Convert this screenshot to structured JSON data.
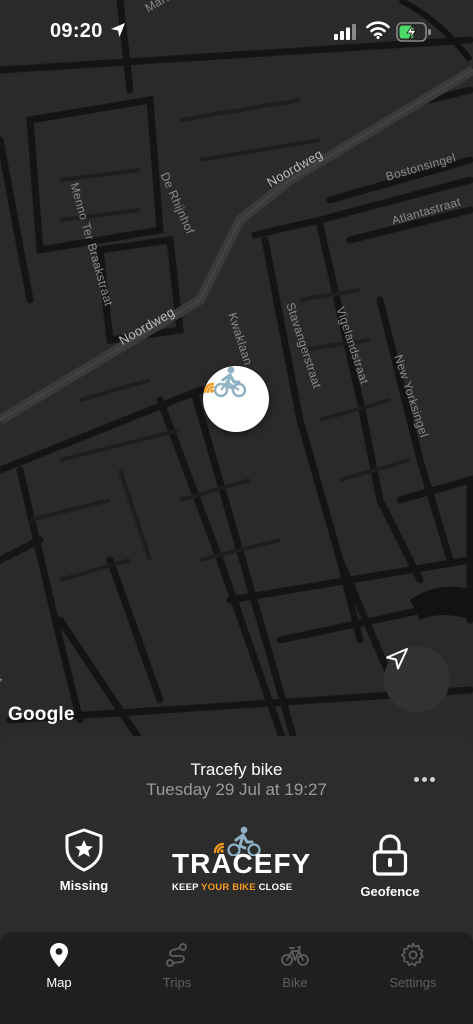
{
  "status_bar": {
    "time": "09:20",
    "location_icon": "location-arrow-icon",
    "signal_icon": "cellular-signal-icon",
    "wifi_icon": "wifi-icon",
    "battery_icon": "battery-charging-icon"
  },
  "map": {
    "attribution": "Google",
    "streets": {
      "noordweg": "Noordweg",
      "de_rhijnhof": "De Rhijnhof",
      "memo_ter_braakstraat": "Menno Ter Braakstraat",
      "kwaklaan": "Kwaklaan",
      "stavangerstraat": "Stavangerstraat",
      "vigelandstraat": "Vigelandstraat",
      "new_yorksingel": "New Yorksingel",
      "bostonsingel": "Bostonsingel",
      "atlantastraat": "Atlantastraat",
      "mart": "Marti",
      "astraat": "aat"
    },
    "colors": {
      "background": "#2a2a2b",
      "roads": "#151516",
      "major_road": "#3a3a3b"
    }
  },
  "bottom_sheet": {
    "bike_name": "Tracefy bike",
    "timestamp": "Tuesday 29 Jul at 19:27",
    "more_icon": "more-horizontal-icon",
    "missing_label": "Missing",
    "geofence_label": "Geofence",
    "brand": {
      "wordmark": "TRACEFY",
      "tagline_before": "KEEP ",
      "tagline_accent": "YOUR BIKE",
      "tagline_after": " CLOSE",
      "accent_color": "#f39a1e"
    }
  },
  "tabs": [
    {
      "label": "Map",
      "icon": "map-pin-icon",
      "active": true
    },
    {
      "label": "Trips",
      "icon": "route-icon",
      "active": false
    },
    {
      "label": "Bike",
      "icon": "bicycle-icon",
      "active": false
    },
    {
      "label": "Settings",
      "icon": "gear-icon",
      "active": false
    }
  ]
}
